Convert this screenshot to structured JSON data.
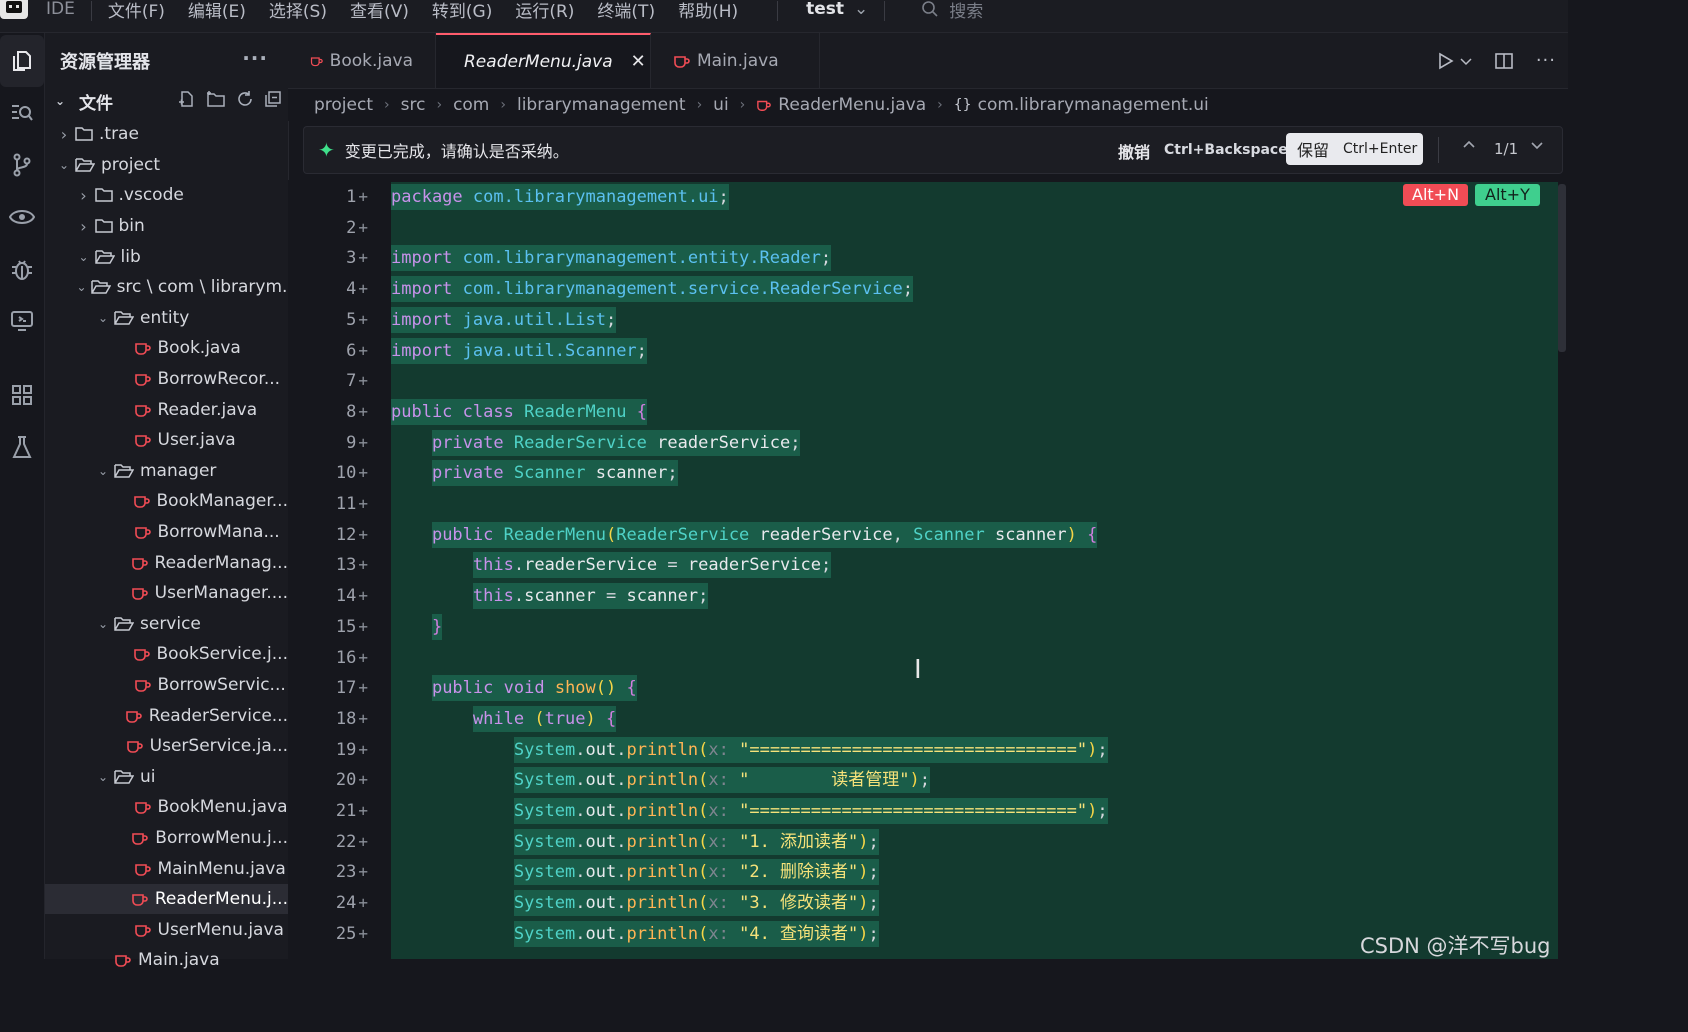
{
  "menubar": {
    "logo": "IDE",
    "ide_label": "IDE",
    "items": [
      "文件(F)",
      "编辑(E)",
      "选择(S)",
      "查看(V)",
      "转到(G)",
      "运行(R)",
      "终端(T)",
      "帮助(H)"
    ],
    "project": "test",
    "search_placeholder": "搜索"
  },
  "sidebar": {
    "title": "资源管理器",
    "more": "···",
    "folder_label": "文件",
    "tree": [
      {
        "label": ".trae",
        "type": "folder",
        "depth": 1,
        "expanded": false
      },
      {
        "label": "project",
        "type": "folder",
        "depth": 1,
        "expanded": true
      },
      {
        "label": ".vscode",
        "type": "folder",
        "depth": 2,
        "expanded": false
      },
      {
        "label": "bin",
        "type": "folder",
        "depth": 2,
        "expanded": false
      },
      {
        "label": "lib",
        "type": "folder",
        "depth": 2,
        "expanded": true
      },
      {
        "label": "src \\ com \\ librarym...",
        "type": "folder",
        "depth": 2,
        "expanded": true
      },
      {
        "label": "entity",
        "type": "folder",
        "depth": 3,
        "expanded": true
      },
      {
        "label": "Book.java",
        "type": "file",
        "depth": 4
      },
      {
        "label": "BorrowRecor...",
        "type": "file",
        "depth": 4
      },
      {
        "label": "Reader.java",
        "type": "file",
        "depth": 4
      },
      {
        "label": "User.java",
        "type": "file",
        "depth": 4
      },
      {
        "label": "manager",
        "type": "folder",
        "depth": 3,
        "expanded": true
      },
      {
        "label": "BookManager...",
        "type": "file",
        "depth": 4
      },
      {
        "label": "BorrowMana...",
        "type": "file",
        "depth": 4
      },
      {
        "label": "ReaderManag...",
        "type": "file",
        "depth": 4
      },
      {
        "label": "UserManager....",
        "type": "file",
        "depth": 4
      },
      {
        "label": "service",
        "type": "folder",
        "depth": 3,
        "expanded": true
      },
      {
        "label": "BookService.j...",
        "type": "file",
        "depth": 4
      },
      {
        "label": "BorrowServic...",
        "type": "file",
        "depth": 4
      },
      {
        "label": "ReaderService...",
        "type": "file",
        "depth": 4
      },
      {
        "label": "UserService.ja...",
        "type": "file",
        "depth": 4
      },
      {
        "label": "ui",
        "type": "folder",
        "depth": 3,
        "expanded": true
      },
      {
        "label": "BookMenu.java",
        "type": "file",
        "depth": 4
      },
      {
        "label": "BorrowMenu.j...",
        "type": "file",
        "depth": 4
      },
      {
        "label": "MainMenu.java",
        "type": "file",
        "depth": 4
      },
      {
        "label": "ReaderMenu.j...",
        "type": "file",
        "depth": 4,
        "selected": true
      },
      {
        "label": "UserMenu.java",
        "type": "file",
        "depth": 4
      },
      {
        "label": "Main.java",
        "type": "file",
        "depth": 3
      }
    ]
  },
  "tabs": [
    {
      "label": "Book.java",
      "active": false
    },
    {
      "label": "ReaderMenu.java",
      "active": true
    },
    {
      "label": "Main.java",
      "active": false
    }
  ],
  "breadcrumb": [
    "project",
    "src",
    "com",
    "librarymanagement",
    "ui",
    "ReaderMenu.java",
    "com.librarymanagement.ui"
  ],
  "notice": {
    "message": "变更已完成，请确认是否采纳。",
    "undo_label": "撤销",
    "undo_shortcut": "Ctrl+Backspace",
    "keep_label": "保留",
    "keep_shortcut": "Ctrl+Enter",
    "counter": "1/1"
  },
  "editor": {
    "reject_key": "Alt+N",
    "accept_key": "Alt+Y",
    "line_numbers": [
      "1",
      "2",
      "3",
      "4",
      "5",
      "6",
      "7",
      "8",
      "9",
      "10",
      "11",
      "12",
      "13",
      "14",
      "15",
      "16",
      "17",
      "18",
      "19",
      "20",
      "21",
      "22",
      "23",
      "24",
      "25"
    ],
    "lines": [
      "package com.librarymanagement.ui;",
      "",
      "import com.librarymanagement.entity.Reader;",
      "import com.librarymanagement.service.ReaderService;",
      "import java.util.List;",
      "import java.util.Scanner;",
      "",
      "public class ReaderMenu {",
      "    private ReaderService readerService;",
      "    private Scanner scanner;",
      "",
      "    public ReaderMenu(ReaderService readerService, Scanner scanner) {",
      "        this.readerService = readerService;",
      "        this.scanner = scanner;",
      "    }",
      "",
      "    public void show() {",
      "        while (true) {",
      "            System.out.println(x: \"================================\");",
      "            System.out.println(x: \"        读者管理\");",
      "            System.out.println(x: \"================================\");",
      "            System.out.println(x: \"1. 添加读者\");",
      "            System.out.println(x: \"2. 删除读者\");",
      "            System.out.println(x: \"3. 修改读者\");",
      "            System.out.println(x: \"4. 查询读者\");"
    ]
  },
  "watermark": "CSDN @洋不写bug"
}
